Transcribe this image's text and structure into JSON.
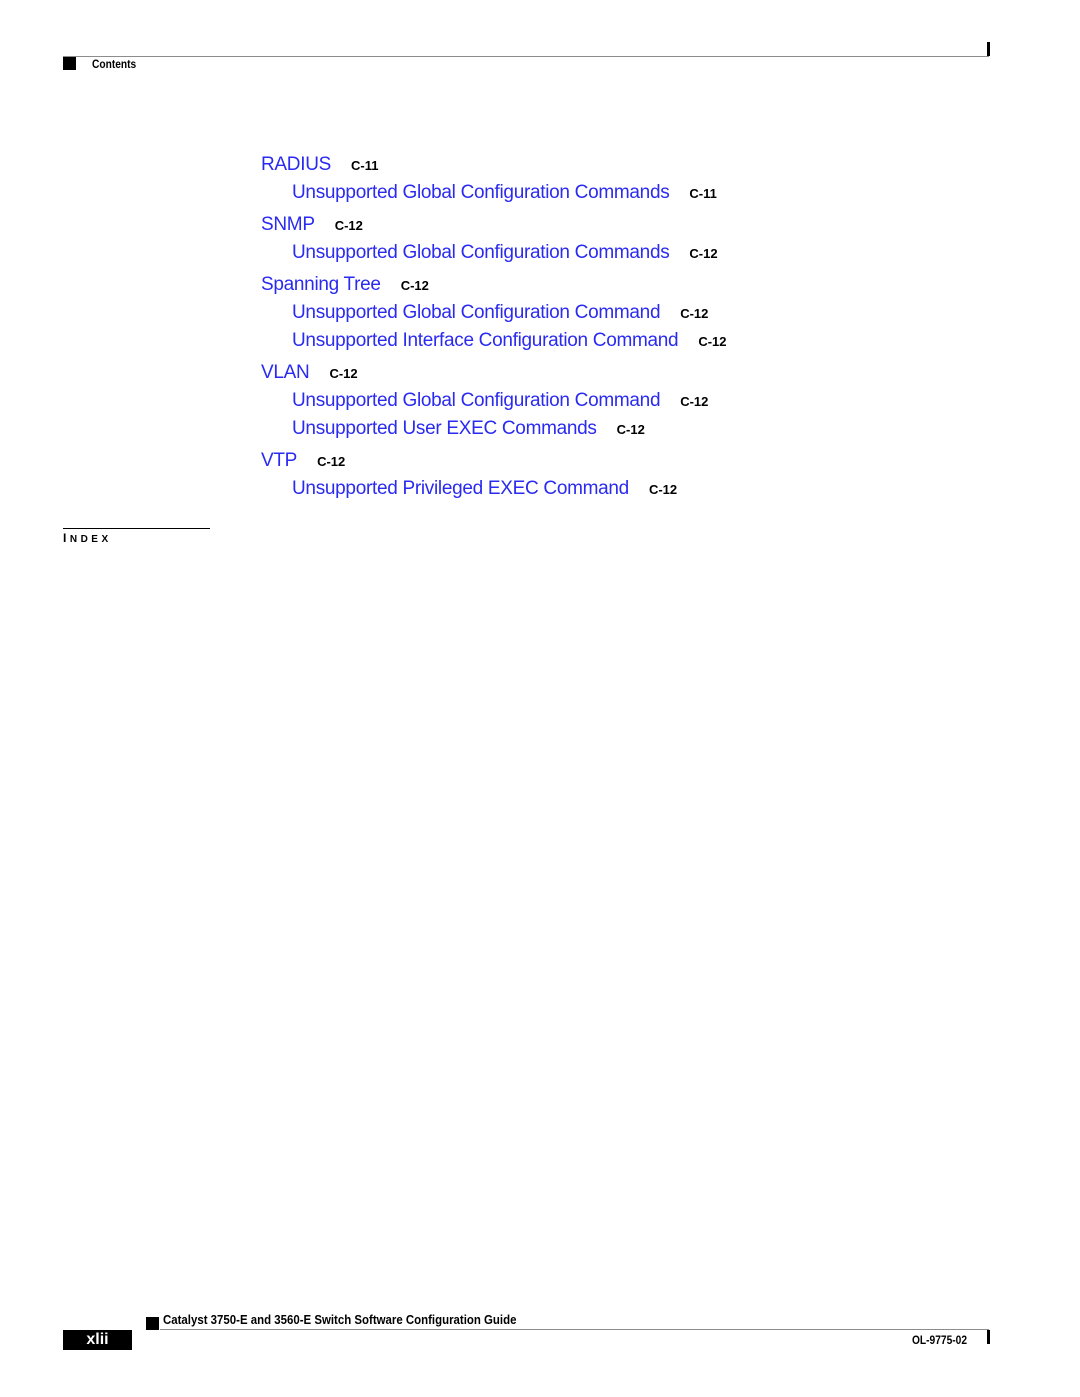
{
  "header": {
    "section_label": "Contents"
  },
  "toc": {
    "entries": [
      {
        "level": 1,
        "title": "RADIUS",
        "page": "C-11"
      },
      {
        "level": 2,
        "title": "Unsupported Global Configuration Commands",
        "page": "C-11"
      },
      {
        "level": 1,
        "title": "SNMP",
        "page": "C-12"
      },
      {
        "level": 2,
        "title": "Unsupported Global Configuration Commands",
        "page": "C-12"
      },
      {
        "level": 1,
        "title": "Spanning Tree",
        "page": "C-12"
      },
      {
        "level": 2,
        "title": "Unsupported Global Configuration Command",
        "page": "C-12"
      },
      {
        "level": 2,
        "title": "Unsupported Interface Configuration Command",
        "page": "C-12"
      },
      {
        "level": 1,
        "title": "VLAN",
        "page": "C-12"
      },
      {
        "level": 2,
        "title": "Unsupported Global Configuration Command",
        "page": "C-12"
      },
      {
        "level": 2,
        "title": "Unsupported User EXEC Commands",
        "page": "C-12"
      },
      {
        "level": 1,
        "title": "VTP",
        "page": "C-12"
      },
      {
        "level": 2,
        "title": "Unsupported Privileged EXEC Command",
        "page": "C-12"
      }
    ],
    "link_color": "#2a2af0"
  },
  "index_section": {
    "first_letter": "I",
    "rest": "NDEX"
  },
  "footer": {
    "guide_title": "Catalyst 3750-E and 3560-E Switch Software Configuration Guide",
    "page_number": "xlii",
    "doc_number": "OL-9775-02"
  }
}
